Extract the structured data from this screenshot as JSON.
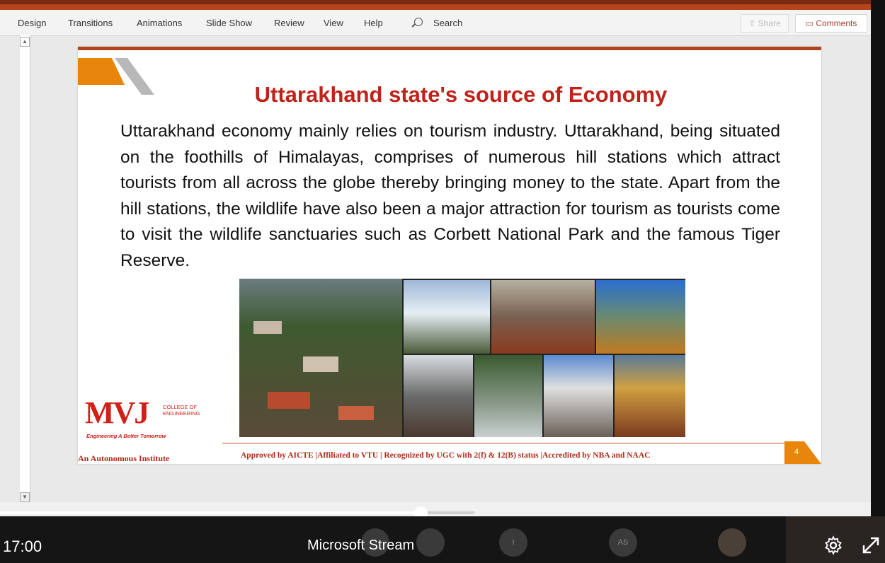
{
  "ribbon": {
    "tabs": [
      "Design",
      "Transitions",
      "Animations",
      "Slide Show",
      "Review",
      "View",
      "Help"
    ],
    "search_label": "Search",
    "share_label": "Share",
    "comments_label": "Comments"
  },
  "slide": {
    "title": "Uttarakhand state's source of Economy",
    "body": "Uttarakhand economy mainly relies on tourism industry. Uttarakhand, being situated on the foothills of Himalayas, comprises of numerous hill stations which attract tourists from all across the globe thereby bringing money to the state. Apart from the hill stations, the wildlife have also been a major attraction for tourism as tourists come to visit the wildlife sanctuaries such as Corbett National Park and the famous Tiger Reserve.",
    "logo": {
      "mark": "MVJ",
      "line1": "COLLEGE OF",
      "line2": "ENGINEERING",
      "tagline": "Engineering A Better Tomorrow"
    },
    "footer_left": "An Autonomous Institute",
    "footer_mid": "Approved by AICTE |Affiliated to VTU | Recognized by UGC with 2(f) & 12(B) status |Accredited by NBA and NAAC",
    "page_number": "4"
  },
  "player": {
    "time": "17:00",
    "brand": "Microsoft Stream",
    "avatar_1": "I",
    "avatar_2": "AS",
    "progress_fraction": 0.476
  },
  "colors": {
    "title_red": "#c0221a",
    "accent_orange": "#e8860c",
    "top_bar": "#b3441b"
  }
}
